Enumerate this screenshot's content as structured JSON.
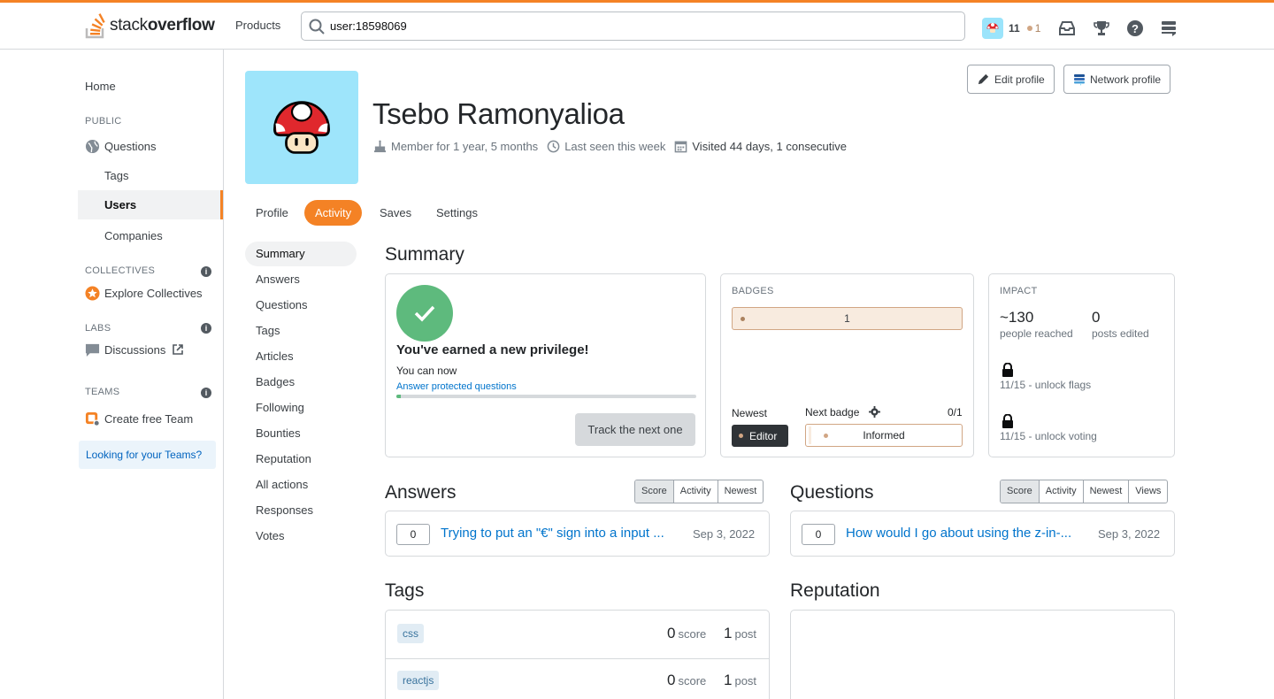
{
  "topbar": {
    "logo_light": "stack",
    "logo_bold": "overflow",
    "products": "Products",
    "search_value": "user:18598069",
    "reputation": "11",
    "bronze_count": "1"
  },
  "leftnav": {
    "home": "Home",
    "public_heading": "PUBLIC",
    "questions": "Questions",
    "tags": "Tags",
    "users": "Users",
    "companies": "Companies",
    "collectives_heading": "COLLECTIVES",
    "explore_collectives": "Explore Collectives",
    "labs_heading": "LABS",
    "discussions": "Discussions",
    "teams_heading": "TEAMS",
    "create_team": "Create free Team",
    "looking_for_teams": "Looking for your Teams?"
  },
  "profile": {
    "name": "Tsebo Ramonyalioa",
    "member_for": "Member for 1 year, 5 months",
    "last_seen": "Last seen this week",
    "visited": "Visited 44 days, 1 consecutive",
    "edit_profile": "Edit profile",
    "network_profile": "Network profile"
  },
  "tabs": [
    "Profile",
    "Activity",
    "Saves",
    "Settings"
  ],
  "activity_nav": [
    "Summary",
    "Answers",
    "Questions",
    "Tags",
    "Articles",
    "Badges",
    "Following",
    "Bounties",
    "Reputation",
    "All actions",
    "Responses",
    "Votes"
  ],
  "summary": {
    "heading": "Summary",
    "privilege_title": "You've earned a new privilege!",
    "privilege_sub": "You can now",
    "privilege_link": "Answer protected questions",
    "privilege_progress": 0.015,
    "track_button": "Track the next one"
  },
  "badges": {
    "label": "BADGES",
    "bronze_total": "1",
    "newest_label": "Newest",
    "newest_badge": "Editor",
    "next_label": "Next badge",
    "next_progress": "0/1",
    "next_badge": "Informed"
  },
  "impact": {
    "label": "IMPACT",
    "people_reached": "~130",
    "people_reached_label": "people reached",
    "posts_edited": "0",
    "posts_edited_label": "posts edited",
    "unlock_flags": "11/15 - unlock flags",
    "unlock_voting": "11/15 - unlock voting"
  },
  "answers": {
    "heading": "Answers",
    "sort": [
      "Score",
      "Activity",
      "Newest"
    ],
    "rows": [
      {
        "score": "0",
        "title": "Trying to put an \"€\" sign into a input ...",
        "date": "Sep 3, 2022"
      }
    ]
  },
  "questions": {
    "heading": "Questions",
    "sort": [
      "Score",
      "Activity",
      "Newest",
      "Views"
    ],
    "rows": [
      {
        "score": "0",
        "title": "How would I go about using the z-in-...",
        "date": "Sep 3, 2022"
      }
    ]
  },
  "tags_section": {
    "heading": "Tags",
    "score_label": "score",
    "post_label": "post",
    "rows": [
      {
        "name": "css",
        "score": "0",
        "posts": "1"
      },
      {
        "name": "reactjs",
        "score": "0",
        "posts": "1"
      }
    ]
  },
  "reputation": {
    "heading": "Reputation"
  },
  "colors": {
    "accent": "#f48225",
    "link": "#0074cc",
    "success": "#5eba7d",
    "bronze": "#d1a684"
  }
}
